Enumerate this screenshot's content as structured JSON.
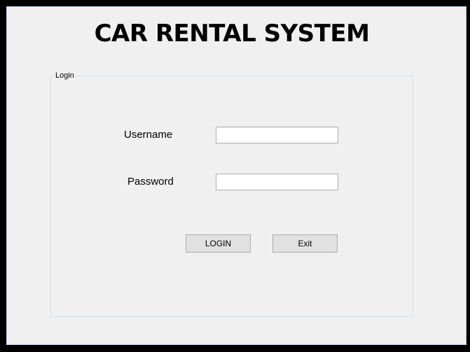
{
  "app": {
    "title": "CAR RENTAL SYSTEM"
  },
  "login_group": {
    "legend": "Login",
    "username_label": "Username",
    "username_value": "",
    "password_label": "Password",
    "password_value": "",
    "login_button": "LOGIN",
    "exit_button": "Exit"
  },
  "colors": {
    "window_frame": "#000000",
    "client_background": "#f0f0f0",
    "button_background": "#e1e1e1",
    "input_border": "#abadb3"
  }
}
